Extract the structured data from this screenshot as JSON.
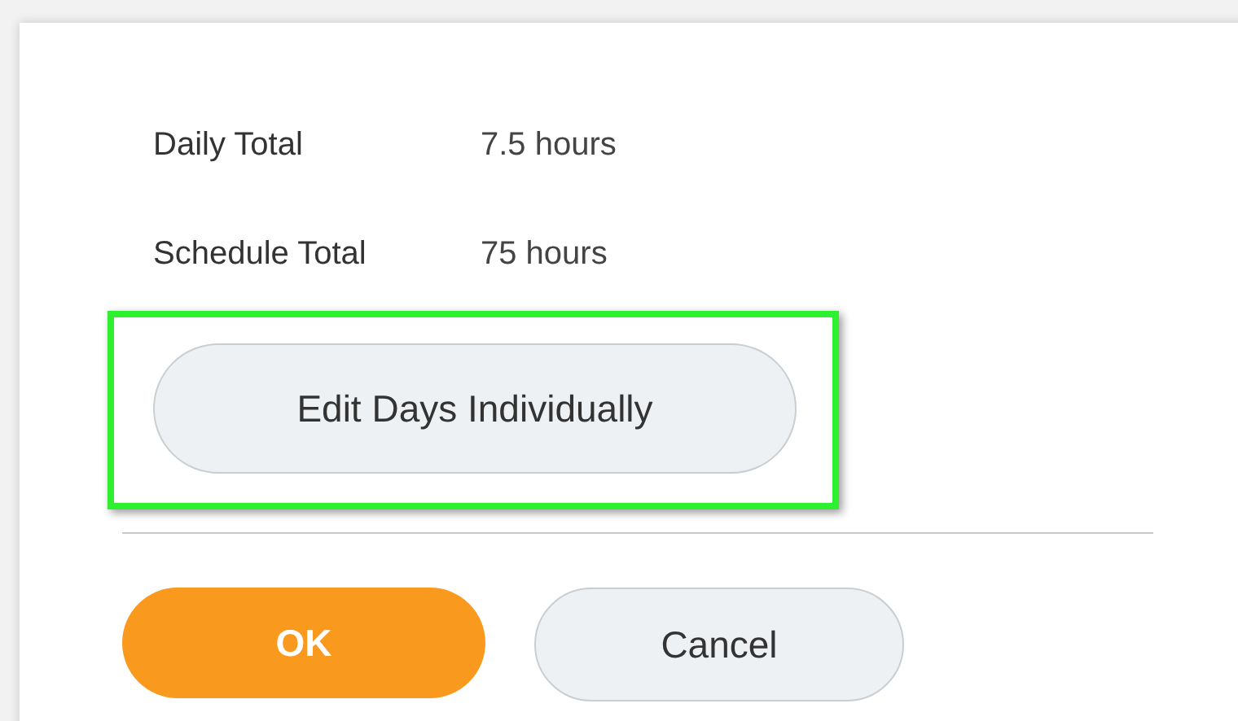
{
  "fields": [
    {
      "label": "Daily Total",
      "value": "7.5 hours"
    },
    {
      "label": "Schedule Total",
      "value": "75 hours"
    }
  ],
  "edit_button": {
    "label": "Edit Days Individually",
    "highlighted": true
  },
  "buttons": [
    {
      "label": "OK",
      "kind": "primary"
    },
    {
      "label": "Cancel",
      "kind": "secondary"
    }
  ]
}
